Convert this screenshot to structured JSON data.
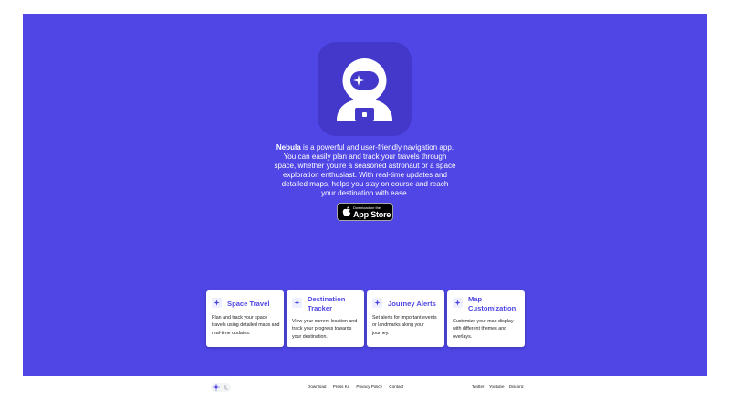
{
  "hero": {
    "background": "#4f46e5",
    "icon": "astronaut-icon",
    "brand": "Nebula",
    "description": " is a powerful and user-friendly navigation app. You can easily plan and track your travels through space, whether you're a seasoned astronaut or a space exploration enthusiast. With real-time updates and detailed maps, helps you stay on course and reach your destination with ease.",
    "store_button": {
      "small": "Download on the",
      "big": "App Store",
      "icon": "apple-icon"
    }
  },
  "features": [
    {
      "icon": "spark-icon",
      "title": "Space Travel",
      "text": "Plan and track your space travels using detailed maps and real-time updates."
    },
    {
      "icon": "spark-icon",
      "title": "Destination Tracker",
      "text": "View your current location and track your progress towards your destination."
    },
    {
      "icon": "spark-icon",
      "title": "Journey Alerts",
      "text": "Set alerts for important events or landmarks along your journey."
    },
    {
      "icon": "spark-icon",
      "title": "Map Customization",
      "text": "Customize your map display with different themes and overlays."
    }
  ],
  "footer": {
    "theme_toggle": {
      "light_icon": "sun-icon",
      "dark_icon": "moon-icon"
    },
    "nav_links": [
      "Download",
      "Press Kit",
      "Privacy Policy",
      "Contact"
    ],
    "social_links": [
      "Twitter",
      "Youtube",
      "Discord"
    ]
  }
}
